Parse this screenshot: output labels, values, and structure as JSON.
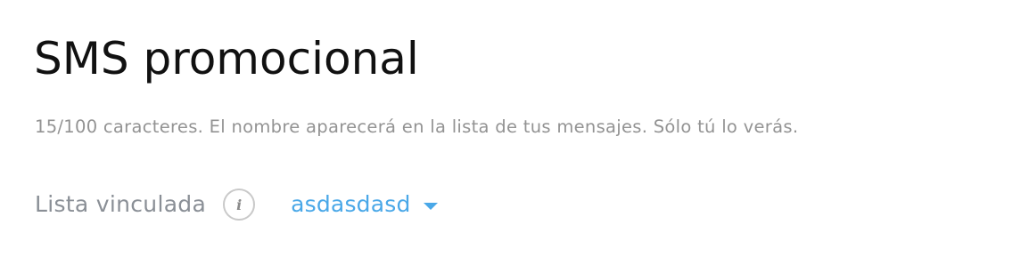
{
  "header": {
    "title": "SMS promocional"
  },
  "name_field": {
    "hint": "15/100 caracteres. El nombre aparecerá en la lista de tus mensajes. Sólo tú lo verás."
  },
  "linked_list": {
    "label": "Lista vinculada",
    "info_icon_glyph": "i",
    "selected_value": "asdasdasd"
  },
  "colors": {
    "title": "#111111",
    "hint": "#939393",
    "label": "#8a8f96",
    "accent": "#4aa8e8",
    "icon_border": "#c9c9c9"
  },
  "icons": {
    "info": "info-icon",
    "dropdown": "chevron-down-icon"
  }
}
